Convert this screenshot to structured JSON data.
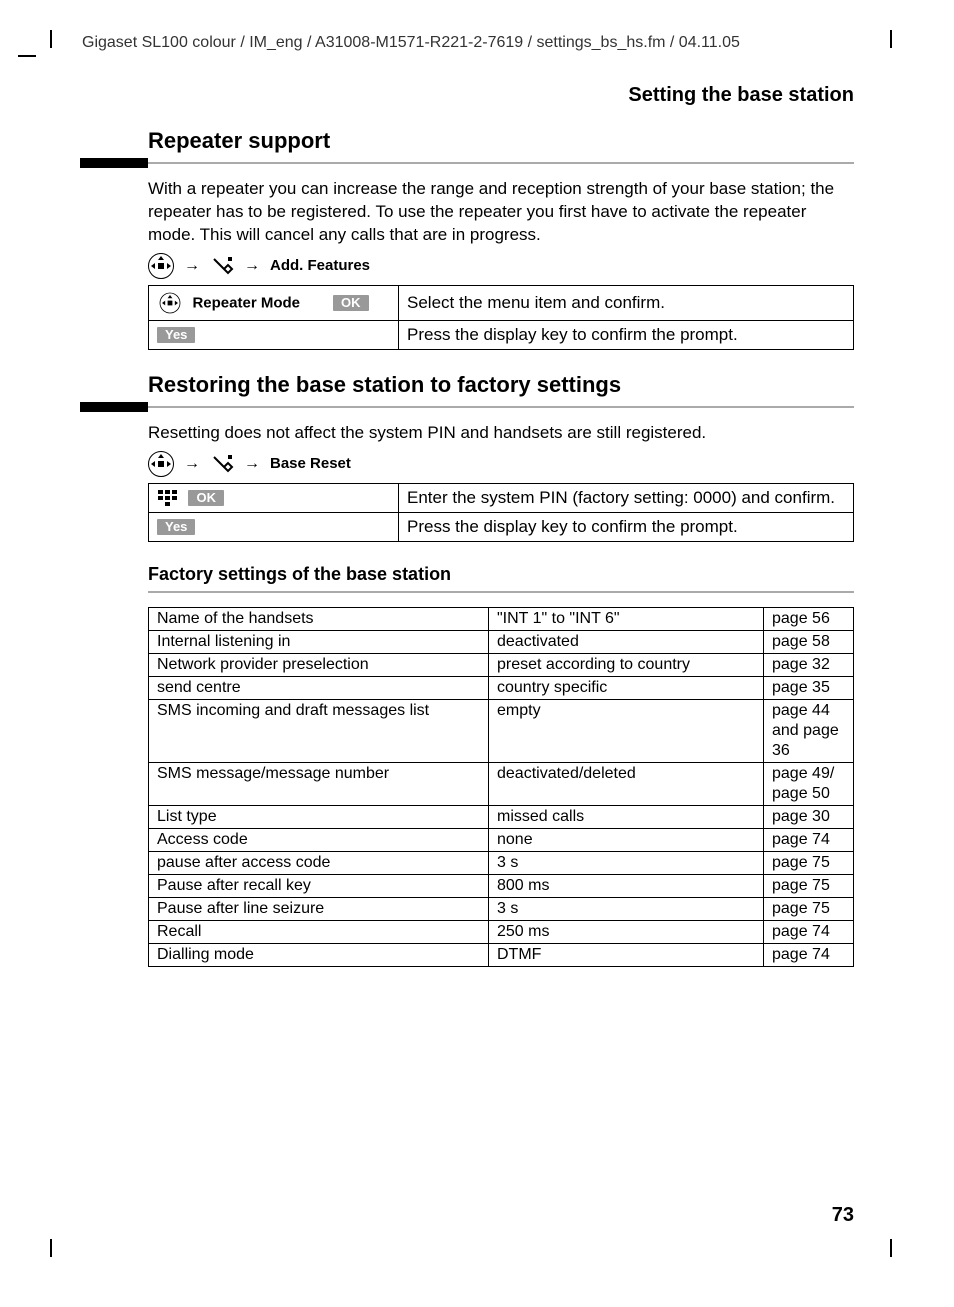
{
  "header": "Gigaset SL100 colour / IM_eng / A31008-M1571-R221-2-7619 / settings_bs_hs.fm / 04.11.05",
  "page_title": "Setting the base station",
  "page_number": "73",
  "section1": {
    "title": "Repeater support",
    "para": "With a repeater you can increase the range and reception strength of your base station; the repeater has to be registered. To use the repeater you first have to activate the repeater mode. This will cancel any calls that are in progress.",
    "menupath_label": "Add. Features",
    "row1_label": "Repeater Mode",
    "row1_ok": "OK",
    "row1_desc": "Select the menu item and confirm.",
    "row2_key": "Yes",
    "row2_desc": "Press the display key to confirm the prompt."
  },
  "section2": {
    "title": "Restoring the base station to factory settings",
    "para": "Resetting does not affect the system PIN and handsets are still registered.",
    "menupath_label": "Base Reset",
    "row1_ok": "OK",
    "row1_desc": "Enter the system PIN (factory setting: 0000) and confirm.",
    "row2_key": "Yes",
    "row2_desc": "Press the display key to confirm the prompt."
  },
  "section3": {
    "title": "Factory settings of the base station",
    "rows": [
      {
        "c1": "Name of the handsets",
        "c2": "\"INT 1\" to \"INT 6\"",
        "c3": "page 56"
      },
      {
        "c1": "Internal listening in",
        "c2": "deactivated",
        "c3": "page 58"
      },
      {
        "c1": "Network provider preselection",
        "c2": "preset according to country",
        "c3": "page 32"
      },
      {
        "c1": "send centre",
        "c2": "country specific",
        "c3": "page 35"
      },
      {
        "c1": "SMS incoming and draft messages list",
        "c2": "empty",
        "c3": "page 44 and page 36"
      },
      {
        "c1": "SMS message/message number",
        "c2": "deactivated/deleted",
        "c3": "page 49/ page 50"
      },
      {
        "c1": "List type",
        "c2": "missed calls",
        "c3": "page 30"
      },
      {
        "c1": "Access code",
        "c2": "none",
        "c3": "page 74"
      },
      {
        "c1": "pause after access code",
        "c2": "3 s",
        "c3": "page 75"
      },
      {
        "c1": "Pause after recall key",
        "c2": "800 ms",
        "c3": "page 75"
      },
      {
        "c1": "Pause after line seizure",
        "c2": "3 s",
        "c3": "page 75"
      },
      {
        "c1": "Recall",
        "c2": "250 ms",
        "c3": "page 74"
      },
      {
        "c1": "Dialling mode",
        "c2": "DTMF",
        "c3": "page 74"
      }
    ]
  }
}
